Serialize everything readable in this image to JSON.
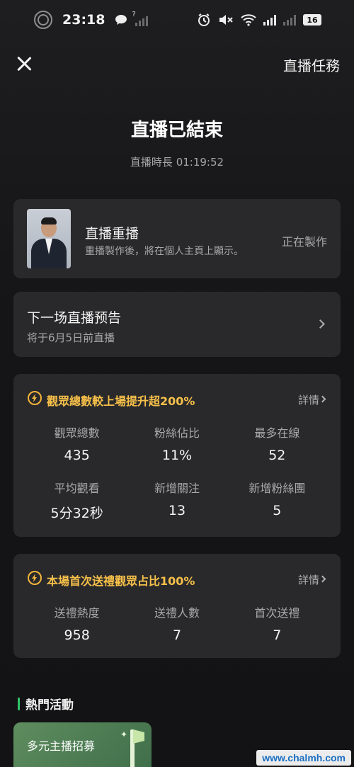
{
  "status_bar": {
    "time": "23:18",
    "battery": "16",
    "icons": [
      "screen-record-icon",
      "chat-bubble-icon",
      "no-sim-signal-icon",
      "alarm-icon",
      "mute-icon",
      "wifi-icon",
      "signal-icon",
      "signal-icon-2"
    ]
  },
  "nav": {
    "close_icon": "close-icon",
    "task_label": "直播任務"
  },
  "header": {
    "title": "直播已結束",
    "duration": "直播時長 01:19:52"
  },
  "replay": {
    "title": "直播重播",
    "description": "重播製作後，將在個人主頁上顯示。",
    "status": "正在製作"
  },
  "preview": {
    "title": "下一场直播预告",
    "subtitle": "将于6月5日前直播"
  },
  "audience_stats": {
    "headline": "觀眾總數較上場提升超200%",
    "detail_label": "詳情",
    "items": [
      {
        "label": "觀眾總數",
        "value": "435"
      },
      {
        "label": "粉絲佔比",
        "value": "11%"
      },
      {
        "label": "最多在線",
        "value": "52"
      },
      {
        "label": "平均觀看",
        "value": "5分32秒"
      },
      {
        "label": "新增關注",
        "value": "13"
      },
      {
        "label": "新增粉絲團",
        "value": "5"
      }
    ]
  },
  "gift_stats": {
    "headline": "本場首次送禮觀眾占比100%",
    "detail_label": "詳情",
    "items": [
      {
        "label": "送禮熱度",
        "value": "958"
      },
      {
        "label": "送禮人數",
        "value": "7"
      },
      {
        "label": "首次送禮",
        "value": "7"
      }
    ]
  },
  "hot_activities": {
    "section_title": "熱門活動",
    "cards": [
      {
        "label": "多元主播招募"
      }
    ]
  },
  "watermark": "www.chalmh.com",
  "colors": {
    "background": "#151517",
    "card": "#29292b",
    "accent_yellow": "#f7c04a",
    "accent_green": "#2fc46a"
  }
}
